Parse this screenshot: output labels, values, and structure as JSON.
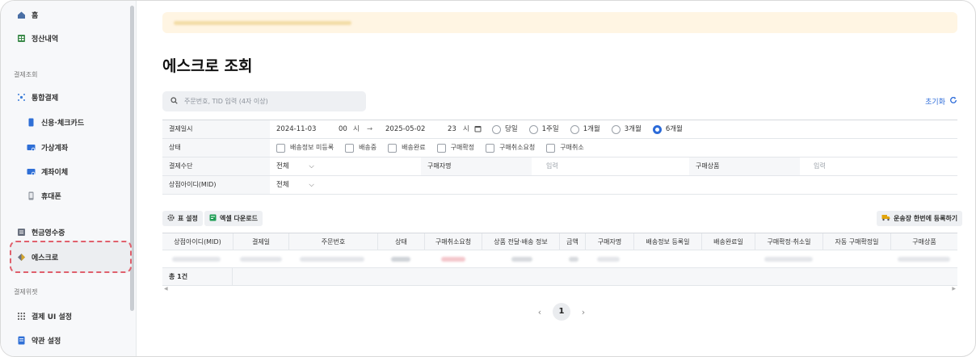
{
  "sidebar": {
    "home": "홈",
    "settlement": "정산내역",
    "section_payment_inquiry": "결제조회",
    "integrated_payment": "통합결제",
    "credit_check_card": "신용·체크카드",
    "virtual_account": "가상계좌",
    "account_transfer": "계좌이체",
    "mobile_phone": "휴대폰",
    "cash_receipt": "현금영수증",
    "escrow": "에스크로",
    "section_payment_widget": "결제위젯",
    "payment_ui_settings": "결제 UI 설정",
    "terms_settings": "약관 설정"
  },
  "page": {
    "title": "에스크로 조회",
    "search_placeholder": "주문번호, TID 입력 (4자 이상)",
    "reset_label": "초기화"
  },
  "filter": {
    "payment_date_label": "결제일시",
    "start_date": "2024-11-03",
    "start_hour": "00",
    "hour_unit": "시",
    "end_date": "2025-05-02",
    "end_hour": "23",
    "periods": [
      {
        "label": "당일",
        "selected": false
      },
      {
        "label": "1주일",
        "selected": false
      },
      {
        "label": "1개월",
        "selected": false
      },
      {
        "label": "3개월",
        "selected": false
      },
      {
        "label": "6개월",
        "selected": true
      }
    ],
    "status_label": "상태",
    "statuses": [
      "배송정보 미등록",
      "배송중",
      "배송완료",
      "구매확정",
      "구매취소요청",
      "구매취소"
    ],
    "method_label": "결제수단",
    "method_value": "전체",
    "buyer_name_label": "구매자명",
    "buyer_name_placeholder": "입력",
    "product_label": "구매상품",
    "product_placeholder": "입력",
    "mid_label": "상점아이디(MID)",
    "mid_value": "전체"
  },
  "toolbar": {
    "table_settings": "표 설정",
    "excel_download": "엑셀 다운로드",
    "register_waybill": "운송장 한번에 등록하기"
  },
  "table": {
    "headers": [
      "상점아이디(MID)",
      "결제일",
      "주문번호",
      "상태",
      "구매취소요청",
      "상품 전달·배송 정보",
      "금액",
      "구매자명",
      "배송정보 등록일",
      "배송완료일",
      "구매확정·취소일",
      "자동 구매확정일",
      "구매상품"
    ],
    "total": "총 1건"
  },
  "pagination": {
    "current_page": "1"
  },
  "colors": {
    "accent": "#2c6bd9",
    "highlight_border": "#e0606c",
    "banner": "#fff5e3"
  }
}
